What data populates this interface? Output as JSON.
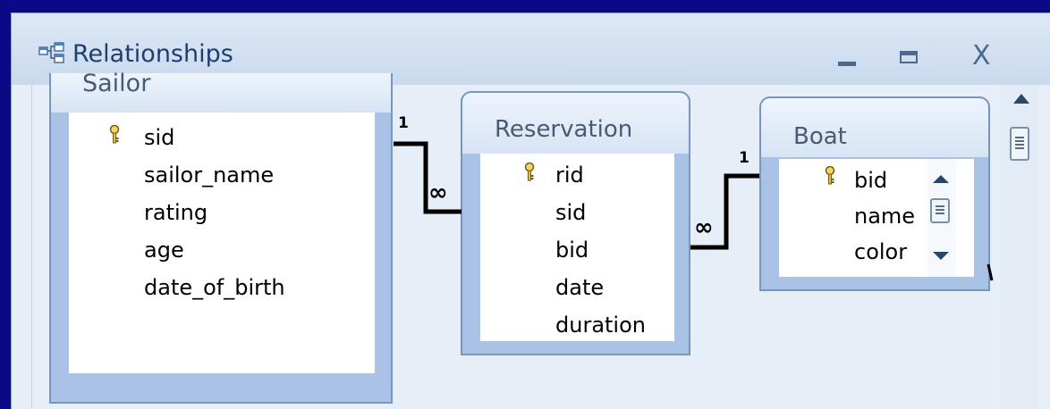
{
  "window": {
    "title": "Relationships",
    "title_icon": "relationships-icon",
    "controls": {
      "minimize": "_",
      "maximize": "maximize",
      "close": "X"
    }
  },
  "tables": {
    "sailor": {
      "title": "Sailor",
      "fields": [
        "sid",
        "sailor_name",
        "rating",
        "age",
        "date_of_birth"
      ],
      "key_field": "sid"
    },
    "reservation": {
      "title": "Reservation",
      "fields": [
        "rid",
        "sid",
        "bid",
        "date",
        "duration"
      ],
      "key_field": "rid"
    },
    "boat": {
      "title": "Boat",
      "fields": [
        "bid",
        "name",
        "color"
      ],
      "key_field": "bid"
    }
  },
  "relationships": [
    {
      "from": "Sailor.sid",
      "to": "Reservation.sid",
      "one_label": "1",
      "many_label": "∞"
    },
    {
      "from": "Boat.bid",
      "to": "Reservation.bid",
      "one_label": "1",
      "many_label": "∞"
    }
  ],
  "colors": {
    "background": "#0a0a86",
    "table_border": "#7695c2",
    "table_frame": "#a9c2e6"
  }
}
